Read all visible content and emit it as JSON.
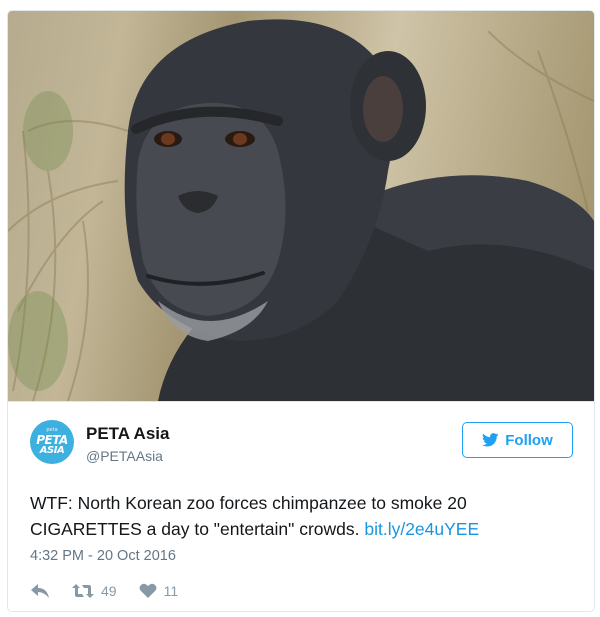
{
  "account": {
    "name": "PETA Asia",
    "handle": "@PETAAsia",
    "avatar_text": {
      "top": "peta",
      "line1": "PETA",
      "line2": "ASIA"
    }
  },
  "follow_button": {
    "label": "Follow",
    "icon": "twitter-bird-icon"
  },
  "tweet": {
    "text": "WTF: North Korean zoo forces chimpanzee to smoke 20 CIGARETTES a day to \"entertain\" crowds. ",
    "link": "bit.ly/2e4uYEE",
    "timestamp": "4:32 PM - 20 Oct 2016"
  },
  "actions": {
    "reply": {
      "icon": "reply-icon"
    },
    "retweet": {
      "icon": "retweet-icon",
      "count": "49"
    },
    "like": {
      "icon": "heart-icon",
      "count": "11"
    }
  },
  "colors": {
    "accent": "#1da1f2",
    "avatar_bg": "#3db0e0",
    "muted": "#657786",
    "link": "#1b95e0"
  }
}
